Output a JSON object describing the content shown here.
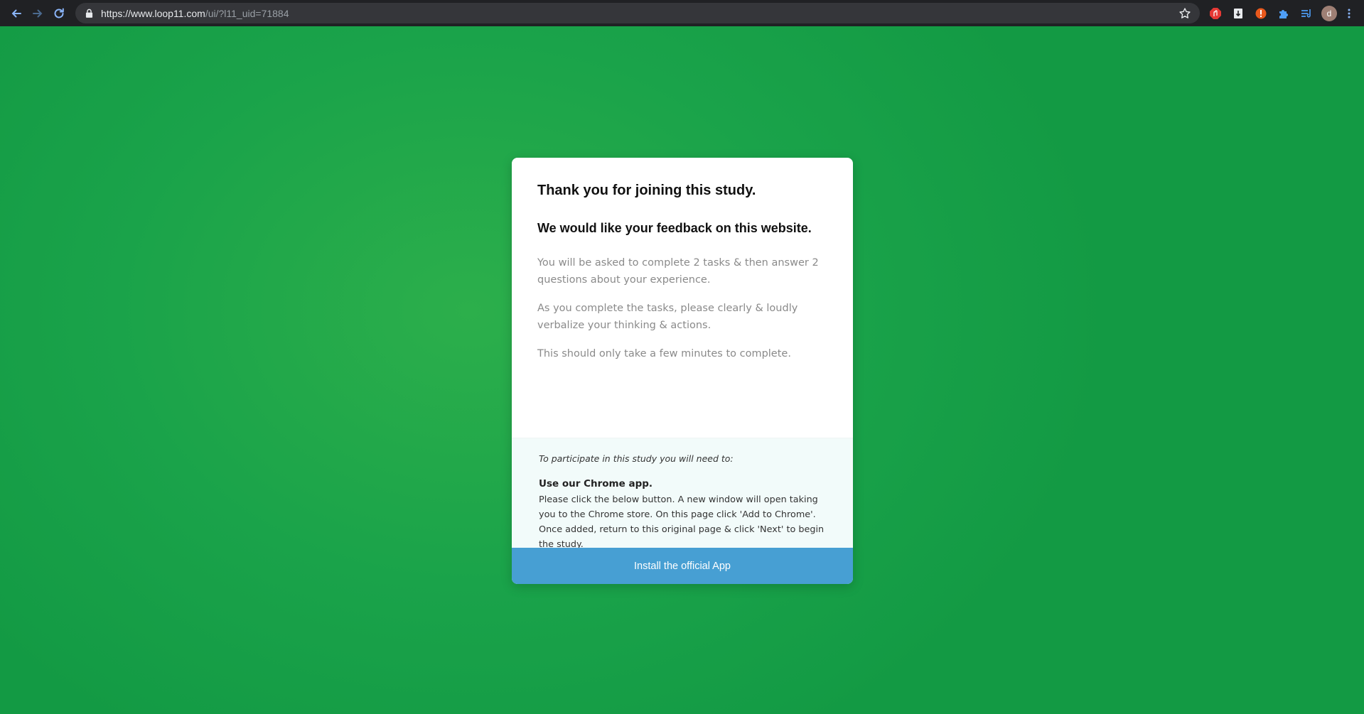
{
  "browser": {
    "url_host": "https://www.loop11.com",
    "url_path": "/ui/?l11_uid=71884",
    "icons": {
      "back": "arrow-left-icon",
      "forward": "arrow-right-icon",
      "reload": "reload-icon",
      "lock": "lock-icon",
      "bookmark": "star-icon"
    },
    "extensions": [
      {
        "name": "adblock-extension-icon",
        "color": "#e53935"
      },
      {
        "name": "bookmark-extension-icon",
        "color": "#ffffff"
      },
      {
        "name": "alert-extension-icon",
        "color": "#e8581c"
      },
      {
        "name": "puzzle-extensions-icon",
        "color": "#4e9ef6"
      },
      {
        "name": "reading-list-icon",
        "color": "#4e9ef6"
      }
    ],
    "profile_initial": "d"
  },
  "card": {
    "title": "Thank you for joining this study.",
    "subtitle": "We would like your feedback on this website.",
    "paragraphs": [
      "You will be asked to complete 2 tasks & then answer 2 questions about your experience.",
      "As you complete the tasks, please clearly & loudly verbalize your thinking & actions.",
      "This should only take a few minutes to complete."
    ],
    "requirements": {
      "intro": "To participate in this study you will need to:",
      "title": "Use our Chrome app.",
      "text": "Please click the below button. A new window will open taking you to the Chrome store. On this page click 'Add to Chrome'. Once added, return to this original page & click 'Next' to begin the study."
    },
    "button_label": "Install the official App"
  },
  "colors": {
    "background": "#1aa34a",
    "button": "#479fd3",
    "requirements_bg": "#f2fbfa"
  }
}
